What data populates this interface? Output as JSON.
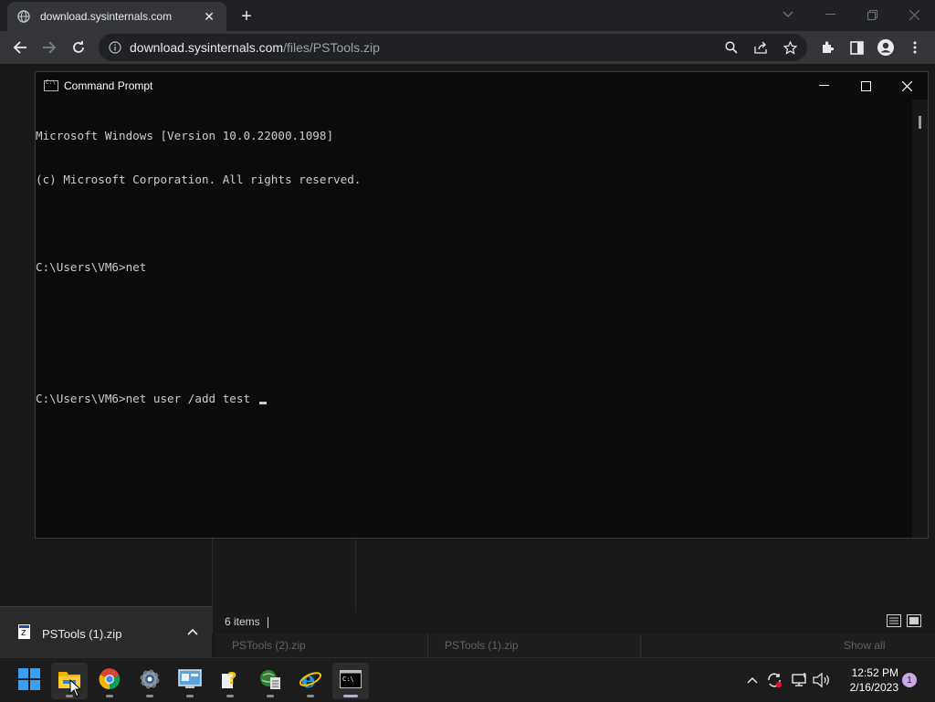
{
  "browser": {
    "tab_title": "download.sysinternals.com",
    "url_host": "download.sysinternals.com",
    "url_path": "/files/PSTools.zip"
  },
  "cmd": {
    "title": "Command Prompt",
    "lines": [
      "Microsoft Windows [Version 10.0.22000.1098]",
      "(c) Microsoft Corporation. All rights reserved.",
      "",
      "C:\\Users\\VM6>net",
      "",
      "",
      "C:\\Users\\VM6>net user /add test "
    ]
  },
  "explorer": {
    "status": "6 items"
  },
  "downloads": {
    "item_name": "PSTools (1).zip",
    "ghost_items": [
      "PSTools (2).zip",
      "PSTools (1).zip",
      "Show all"
    ]
  },
  "taskbar": {
    "apps": [
      "start-icon",
      "file-explorer-icon",
      "chrome-icon",
      "settings-icon",
      "control-panel-icon",
      "help-icon",
      "network-icon",
      "internet-explorer-icon",
      "command-prompt-icon"
    ],
    "time": "12:52 PM",
    "date": "2/16/2023",
    "notification_count": "1"
  },
  "colors": {
    "console_bg": "#0c0c0c",
    "console_text": "#cccccc",
    "chrome_toolbar": "#35363a",
    "taskbar_bg": "#1c1c1c",
    "active_indicator": "#c9a0e8"
  }
}
